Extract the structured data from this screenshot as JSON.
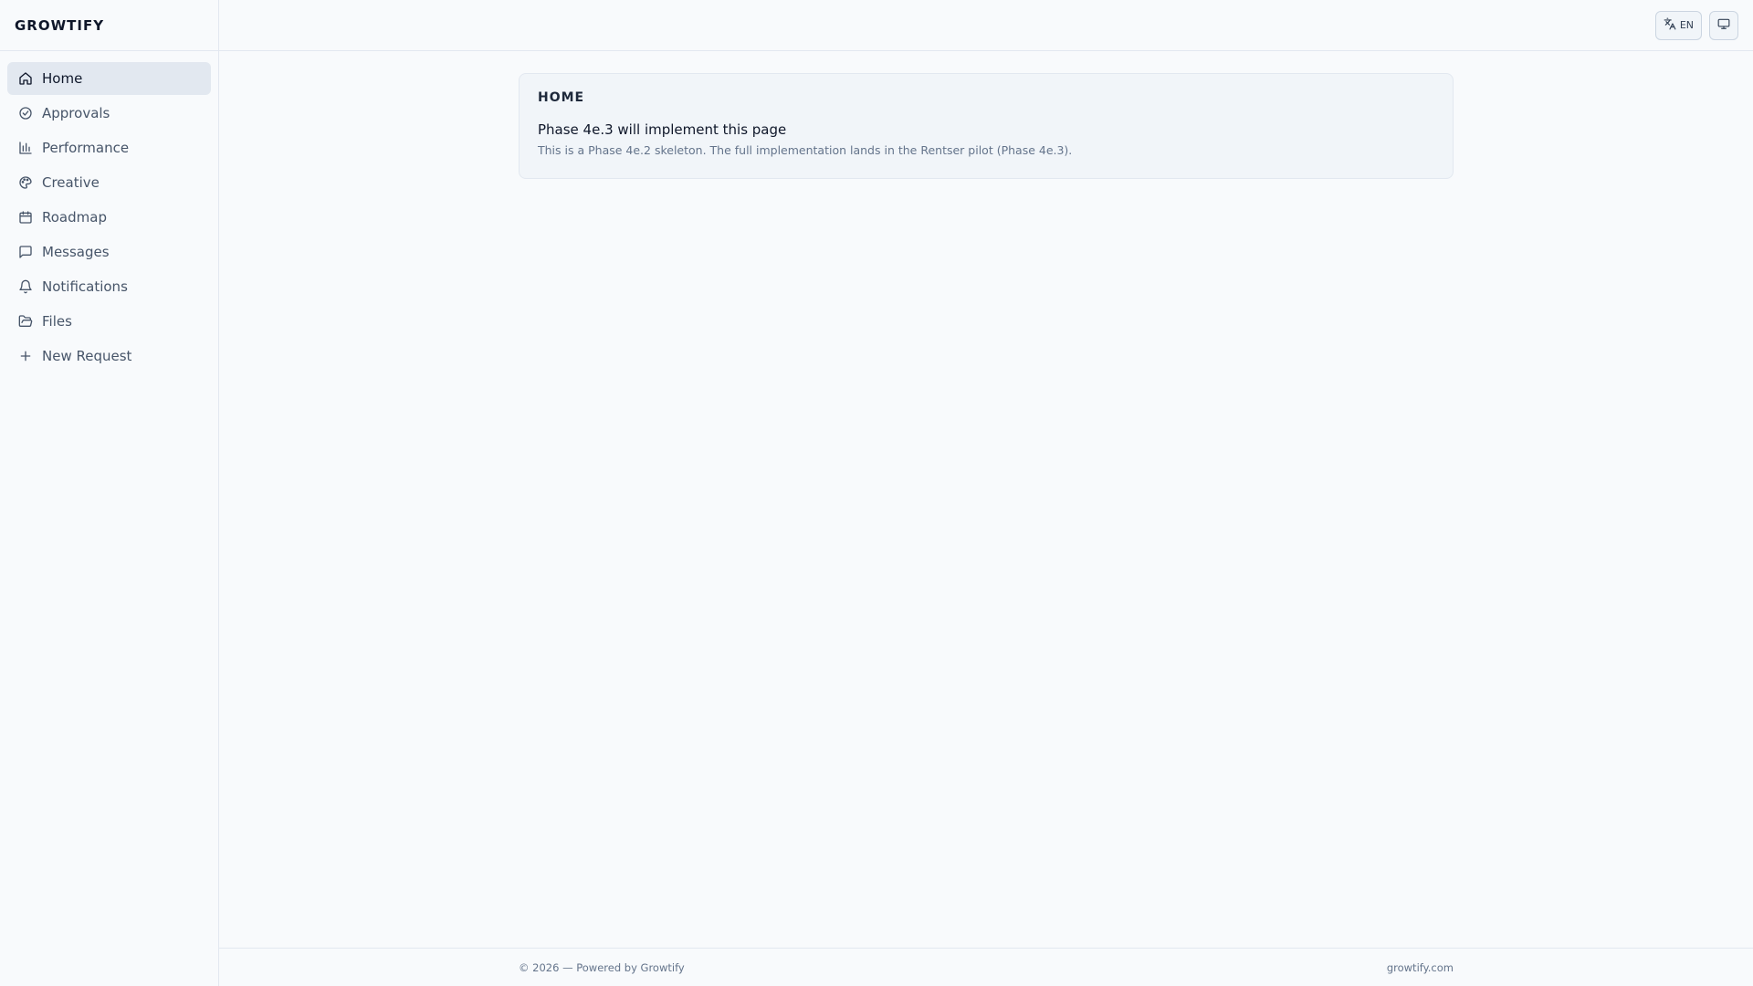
{
  "brand": {
    "name": "GROWTIFY"
  },
  "sidebar": {
    "items": [
      {
        "label": "Home",
        "icon": "home-icon",
        "active": true
      },
      {
        "label": "Approvals",
        "icon": "check-circle-icon"
      },
      {
        "label": "Performance",
        "icon": "bar-chart-icon"
      },
      {
        "label": "Creative",
        "icon": "palette-icon"
      },
      {
        "label": "Roadmap",
        "icon": "calendar-icon"
      },
      {
        "label": "Messages",
        "icon": "message-square-icon"
      },
      {
        "label": "Notifications",
        "icon": "bell-icon"
      },
      {
        "label": "Files",
        "icon": "folder-open-icon"
      },
      {
        "label": "New Request",
        "icon": "plus-icon"
      }
    ]
  },
  "topbar": {
    "language": {
      "label": "EN",
      "icon": "languages-icon"
    },
    "display": {
      "icon": "monitor-icon"
    }
  },
  "card": {
    "title": "HOME",
    "heading": "Phase 4e.3 will implement this page",
    "description": "This is a Phase 4e.2 skeleton. The full implementation lands in the Rentser pilot (Phase 4e.3)."
  },
  "footer": {
    "left": "© 2026 — Powered by Growtify",
    "right": "growtify.com"
  },
  "colors": {
    "background": "#f8fafc",
    "active_nav": "#e2e8f0",
    "border": "#e2e8f0",
    "muted_text": "#64748b"
  }
}
